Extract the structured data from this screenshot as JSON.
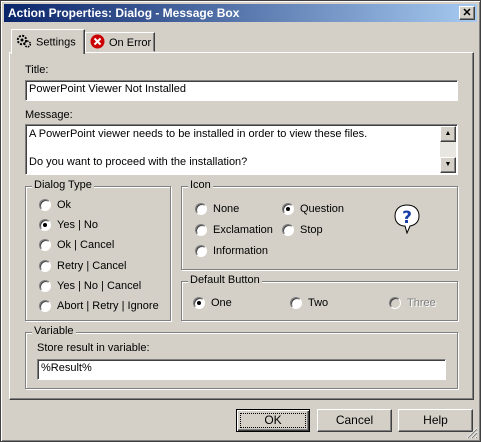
{
  "window": {
    "title": "Action Properties: Dialog - Message Box",
    "close_glyph": "✕"
  },
  "tabs": [
    {
      "label": "Settings",
      "icon": "gear-icon",
      "active": true
    },
    {
      "label": "On Error",
      "icon": "error-icon",
      "active": false
    }
  ],
  "title_field": {
    "label": "Title:",
    "value": "PowerPoint Viewer Not Installed"
  },
  "message_field": {
    "label": "Message:",
    "lines": [
      "A PowerPoint viewer needs to be installed in order to view these files.",
      "",
      "Do you want to proceed with the installation?"
    ]
  },
  "dialog_type": {
    "title": "Dialog Type",
    "options": [
      "Ok",
      "Yes | No",
      "Ok | Cancel",
      "Retry | Cancel",
      "Yes | No | Cancel",
      "Abort | Retry | Ignore"
    ],
    "selected": "Yes | No"
  },
  "icon_group": {
    "title": "Icon",
    "options": [
      "None",
      "Question",
      "Exclamation",
      "Stop",
      "Information"
    ],
    "selected": "Question",
    "preview_icon": "question-icon"
  },
  "default_button": {
    "title": "Default Button",
    "options": [
      "One",
      "Two",
      "Three"
    ],
    "selected": "One",
    "disabled": [
      "Three"
    ]
  },
  "variable": {
    "title": "Variable",
    "label": "Store result in variable:",
    "value": "%Result%"
  },
  "buttons": {
    "ok": "OK",
    "cancel": "Cancel",
    "help": "Help"
  },
  "colors": {
    "face": "#d4d0c8",
    "title_start": "#0a246a",
    "title_end": "#a6caf0",
    "error_red": "#cc0000",
    "help_blue": "#1a3ea8"
  }
}
